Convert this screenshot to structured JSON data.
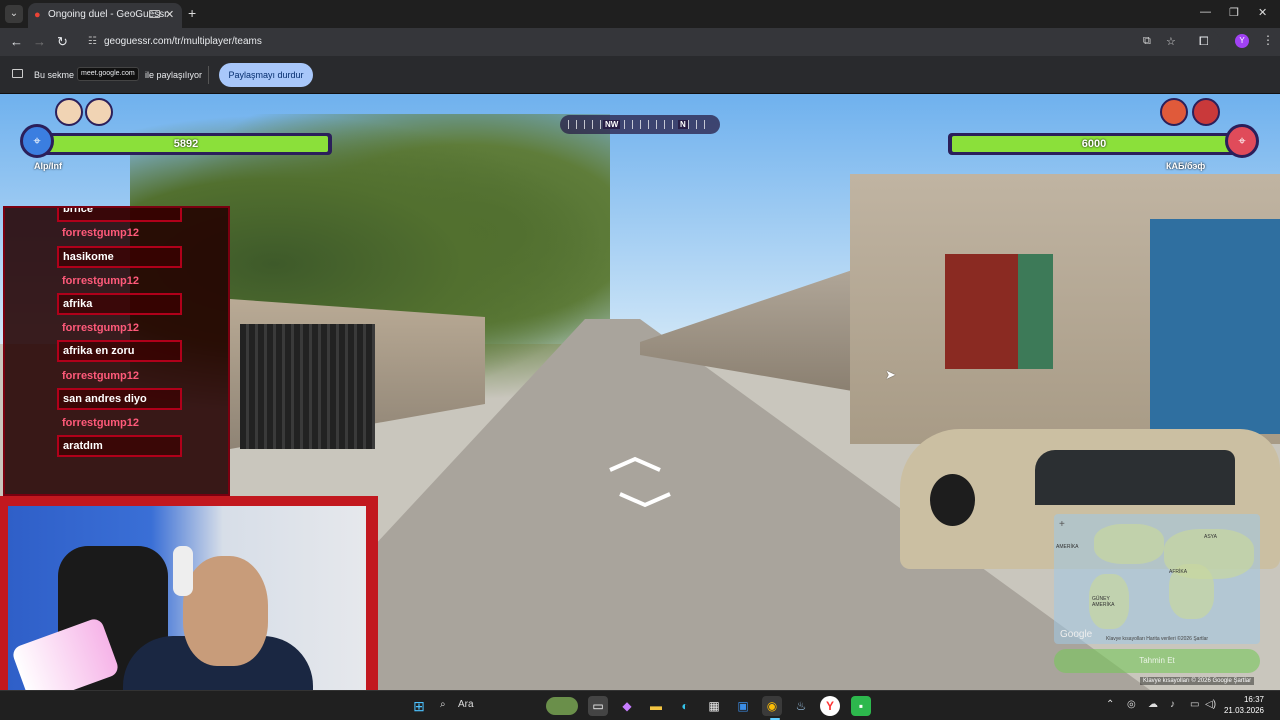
{
  "browser": {
    "tab_title": "Ongoing duel - GeoGuessr",
    "new_tab": "+",
    "url": "geoguessr.com/tr/multiplayer/teams",
    "profile_initial": "Y"
  },
  "sharing": {
    "prefix": "Bu sekme",
    "host": "meet.google.com",
    "suffix": "ile paylaşılıyor",
    "stop_label": "Paylaşmayı durdur"
  },
  "game": {
    "compass_nw": "NW",
    "compass_n": "N",
    "left_team": {
      "health": "5892",
      "name": "Alp/Inf"
    },
    "right_team": {
      "health": "6000",
      "name": "КАБ/бэф"
    }
  },
  "chat": {
    "messages": [
      {
        "user": "",
        "text": "brnce"
      },
      {
        "user": "forrestgump12",
        "text": "hasikome"
      },
      {
        "user": "forrestgump12",
        "text": "afrika"
      },
      {
        "user": "forrestgump12",
        "text": "afrika en zoru"
      },
      {
        "user": "forrestgump12",
        "text": "san andres diyo"
      },
      {
        "user": "forrestgump12",
        "text": "aratdım"
      }
    ]
  },
  "minimap": {
    "plus": "+",
    "labels": [
      "ASYA",
      "AFRİKA",
      "GÜNEY AMERİKA",
      "AMERİKA"
    ],
    "google": "Google",
    "attribution": "Klavye kısayolları   Harita verileri ©2026   Şartlar",
    "guess_label": "Tahmin Et",
    "bottom_attribution": "Klavye kısayolları   © 2026 Google   Şartlar"
  },
  "taskbar": {
    "search_label": "Ara",
    "time": "16:37",
    "date": "21.03.2026"
  },
  "colors": {
    "health_bar": "#8be03a",
    "chat_border": "#b0001a",
    "chat_user": "#ff5a7a",
    "stop_button": "#a8c7fa"
  }
}
